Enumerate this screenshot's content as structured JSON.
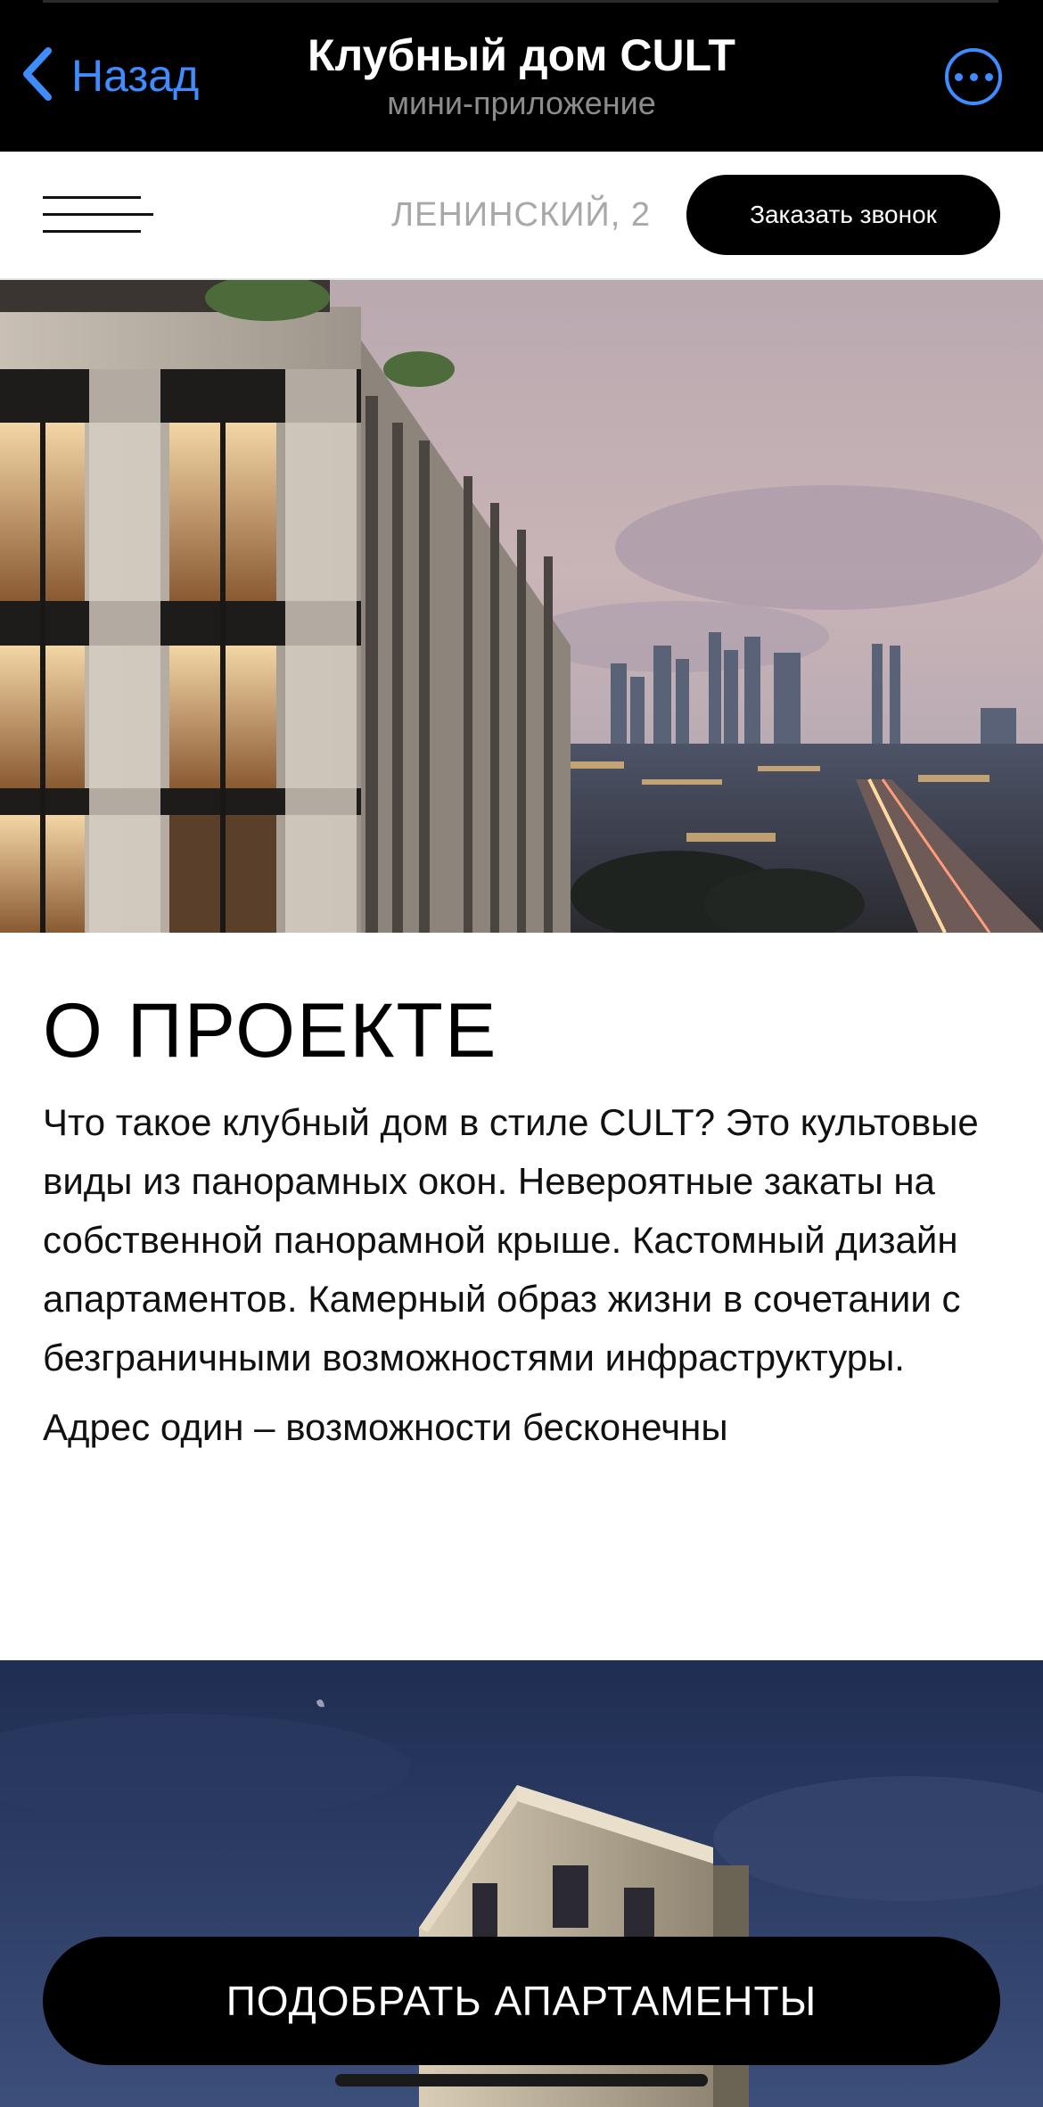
{
  "topbar": {
    "back_label": "Назад",
    "title": "Клубный дом CULT",
    "subtitle": "мини-приложение",
    "accent": "#3f8cff"
  },
  "header": {
    "address": "ЛЕНИНСКИЙ, 2",
    "call_button": "Заказать звонок"
  },
  "about": {
    "title": "О ПРОЕКТЕ",
    "text": "Что такое клубный дом в стиле CULT? Это культовые виды из панорамных окон. Невероятные закаты на собственной панорамной крыше. Кастомный дизайн апартаментов. Камерный образ жизни в сочетании с безграничными возможностями инфраструктуры.",
    "tagline": "Адрес один – возможности бесконечны"
  },
  "cta": {
    "label": "ПОДОБРАТЬ АПАРТАМЕНТЫ"
  }
}
